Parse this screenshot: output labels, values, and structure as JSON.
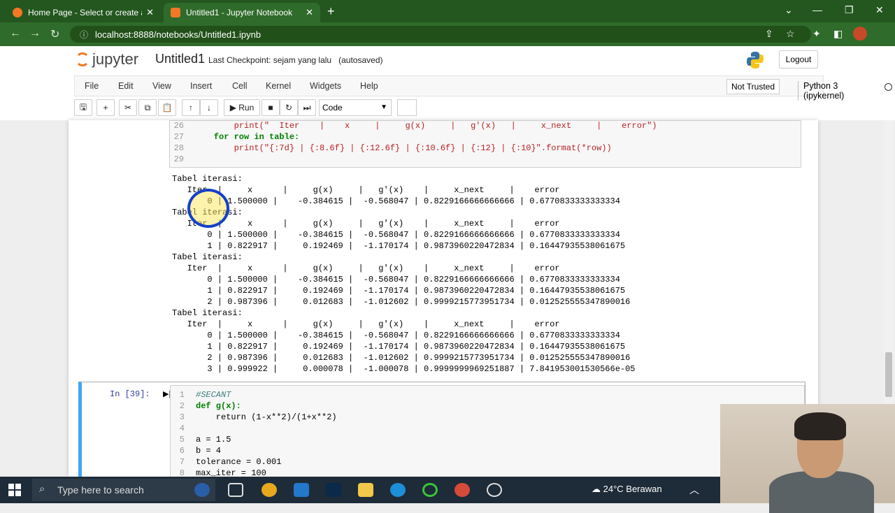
{
  "browser": {
    "tabs": [
      {
        "label": "Home Page - Select or create a n"
      },
      {
        "label": "Untitled1 - Jupyter Notebook"
      }
    ],
    "url": "localhost:8888/notebooks/Untitled1.ipynb"
  },
  "jupyter": {
    "logo_text": "jupyter",
    "notebook_name": "Untitled1",
    "checkpoint": "Last Checkpoint: sejam yang lalu",
    "autosave": "(autosaved)",
    "logout": "Logout",
    "menu": [
      "File",
      "Edit",
      "View",
      "Insert",
      "Cell",
      "Kernel",
      "Widgets",
      "Help"
    ],
    "not_trusted": "Not Trusted",
    "kernel": "Python 3 (ipykernel)",
    "run_label": "Run",
    "cell_type": "Code"
  },
  "cell1": {
    "line_numbers": [
      "26",
      "27",
      "28",
      "29"
    ],
    "lines": [
      "        print(\"  Iter    |    x     |     g(x)     |   g'(x)   |     x_next     |    error\")",
      "    for row in table:",
      "        print(\"{:7d} | {:8.6f} | {:12.6f} | {:10.6f} | {:12} | {:10}\".format(*row))",
      ""
    ]
  },
  "output": [
    "Tabel iterasi:",
    "   Iter  |     x      |     g(x)     |   g'(x)    |     x_next     |    error",
    "       0 | 1.500000 |    -0.384615 |  -0.568047 | 0.8229166666666666 | 0.6770833333333334",
    "Tabel iterasi:",
    "   Iter  |     x      |     g(x)     |   g'(x)    |     x_next     |    error",
    "       0 | 1.500000 |    -0.384615 |  -0.568047 | 0.8229166666666666 | 0.6770833333333334",
    "       1 | 0.822917 |     0.192469 |  -1.170174 | 0.9873960220472834 | 0.16447935538061675",
    "Tabel iterasi:",
    "   Iter  |     x      |     g(x)     |   g'(x)    |     x_next     |    error",
    "       0 | 1.500000 |    -0.384615 |  -0.568047 | 0.8229166666666666 | 0.6770833333333334",
    "       1 | 0.822917 |     0.192469 |  -1.170174 | 0.9873960220472834 | 0.16447935538061675",
    "       2 | 0.987396 |     0.012683 |  -1.012602 | 0.9999215773951734 | 0.012525555347890016",
    "Tabel iterasi:",
    "   Iter  |     x      |     g(x)     |   g'(x)    |     x_next     |    error",
    "       0 | 1.500000 |    -0.384615 |  -0.568047 | 0.8229166666666666 | 0.6770833333333334",
    "       1 | 0.822917 |     0.192469 |  -1.170174 | 0.9873960220472834 | 0.16447935538061675",
    "       2 | 0.987396 |     0.012683 |  -1.012602 | 0.9999215773951734 | 0.012525555347890016",
    "       3 | 0.999922 |     0.000078 |  -1.000078 | 0.9999999969251887 | 7.841953001530566e-05"
  ],
  "cell2": {
    "prompt": "In [39]:",
    "line_numbers": [
      "1",
      "2",
      "3",
      "4",
      "5",
      "6",
      "7",
      "8"
    ],
    "lines": [
      "#SECANT",
      "def g(x):",
      "    return (1-x**2)/(1+x**2)",
      "",
      "a = 1.5",
      "b = 4",
      "tolerance = 0.001",
      "max_iter = 100"
    ]
  },
  "taskbar": {
    "search_placeholder": "Type here to search",
    "weather": "24°C  Berawan"
  }
}
